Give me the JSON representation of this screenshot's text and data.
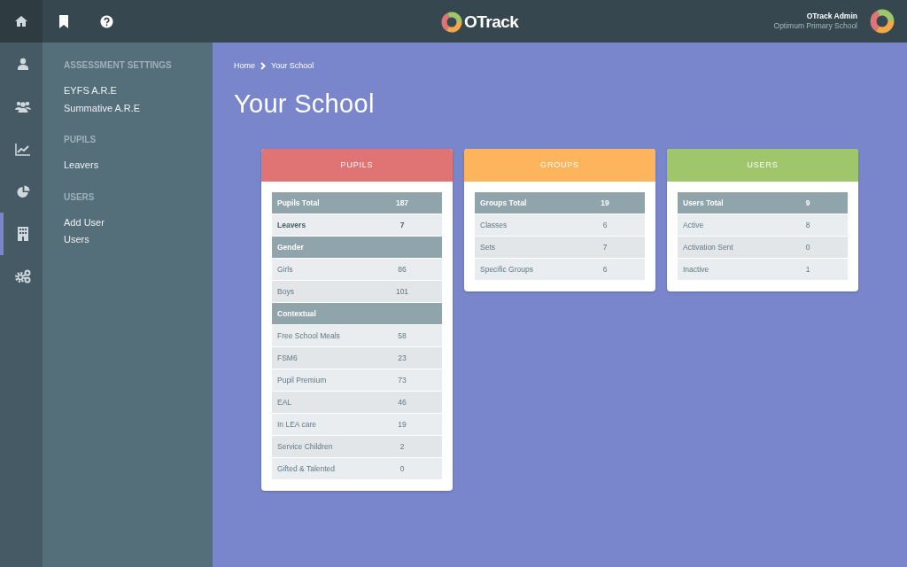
{
  "topbar": {
    "brand": "OTrack",
    "user_name": "OTrack Admin",
    "school": "Optimum Primary School"
  },
  "rail": [
    {
      "selected": false
    },
    {
      "selected": false
    },
    {
      "selected": false
    },
    {
      "selected": false
    },
    {
      "selected": true
    },
    {
      "selected": false
    }
  ],
  "sidebar": {
    "sections": [
      {
        "heading": "ASSESSMENT SETTINGS",
        "items": [
          "EYFS A.R.E",
          "Summative A.R.E"
        ]
      },
      {
        "heading": "PUPILS",
        "items": [
          "Leavers"
        ]
      },
      {
        "heading": "USERS",
        "items": [
          "Add User",
          "Users"
        ]
      }
    ]
  },
  "breadcrumb": [
    "Home",
    "Your School"
  ],
  "page_title": "Your School",
  "cards": [
    {
      "title": "PUPILS",
      "color": "#e07474",
      "rows": [
        {
          "kind": "total",
          "label": "Pupils Total",
          "value": "187"
        },
        {
          "kind": "bold",
          "label": "Leavers",
          "value": "7"
        },
        {
          "kind": "section",
          "label": "Gender"
        },
        {
          "kind": "plain",
          "label": "Girls",
          "value": "86"
        },
        {
          "kind": "plain",
          "label": "Boys",
          "value": "101"
        },
        {
          "kind": "section",
          "label": "Contextual"
        },
        {
          "kind": "plain",
          "label": "Free School Meals",
          "value": "58"
        },
        {
          "kind": "plain",
          "label": "FSM6",
          "value": "23"
        },
        {
          "kind": "plain",
          "label": "Pupil Premium",
          "value": "73"
        },
        {
          "kind": "plain",
          "label": "EAL",
          "value": "46"
        },
        {
          "kind": "plain",
          "label": "In LEA care",
          "value": "19"
        },
        {
          "kind": "plain",
          "label": "Service Children",
          "value": "2"
        },
        {
          "kind": "plain",
          "label": "Gifted & Talented",
          "value": "0"
        }
      ]
    },
    {
      "title": "GROUPS",
      "color": "#fdb45c",
      "rows": [
        {
          "kind": "total",
          "label": "Groups Total",
          "value": "19"
        },
        {
          "kind": "plain",
          "label": "Classes",
          "value": "6"
        },
        {
          "kind": "plain",
          "label": "Sets",
          "value": "7"
        },
        {
          "kind": "plain",
          "label": "Specific Groups",
          "value": "6"
        }
      ]
    },
    {
      "title": "USERS",
      "color": "#9fc66a",
      "rows": [
        {
          "kind": "total",
          "label": "Users Total",
          "value": "9"
        },
        {
          "kind": "plain",
          "label": "Active",
          "value": "8"
        },
        {
          "kind": "plain",
          "label": "Activation Sent",
          "value": "0"
        },
        {
          "kind": "plain",
          "label": "Inactive",
          "value": "1"
        }
      ]
    }
  ]
}
